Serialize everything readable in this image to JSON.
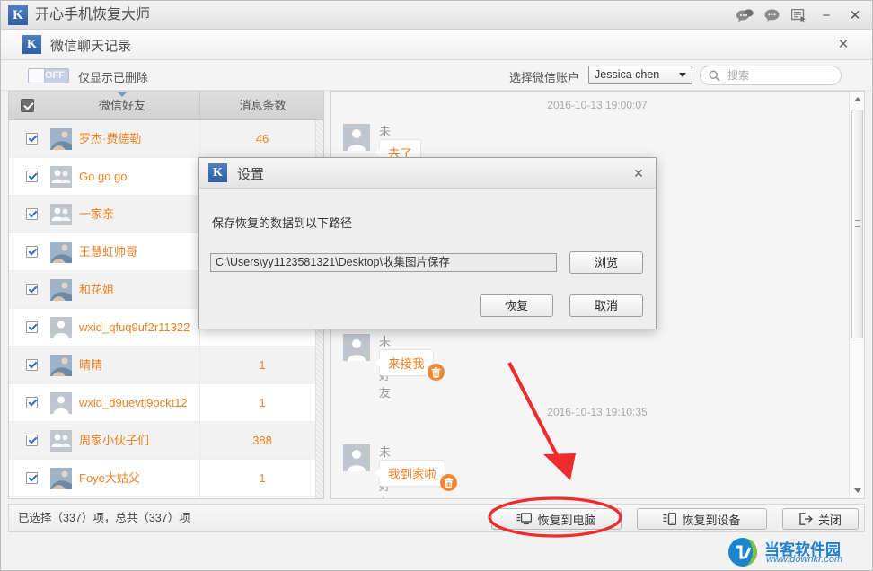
{
  "window": {
    "app_title": "开心手机恢复大师",
    "logo_letter": "K",
    "icons": {
      "chats": "chats-icon",
      "message": "message-icon",
      "feedback": "feedback-icon",
      "minimize": "−",
      "close": "✕"
    }
  },
  "module": {
    "title": "微信聊天记录",
    "close": "✕"
  },
  "toolbar": {
    "toggle_state": "OFF",
    "toggle_label": "仅显示已删除",
    "account_label": "选择微信账户",
    "account_value": "Jessica chen",
    "search_placeholder": "搜索"
  },
  "list": {
    "header": {
      "col_name": "微信好友",
      "col_count": "消息条数"
    },
    "rows": [
      {
        "name": "罗杰·费德勒",
        "count": "46",
        "avatar": "photo",
        "checked": true
      },
      {
        "name": "Go go go",
        "count": "",
        "avatar": "group",
        "checked": true
      },
      {
        "name": "一家亲",
        "count": "",
        "avatar": "group",
        "checked": true
      },
      {
        "name": "王慧虹帅哥",
        "count": "",
        "avatar": "photo",
        "checked": true
      },
      {
        "name": "和花姐",
        "count": "",
        "avatar": "photo",
        "checked": true
      },
      {
        "name": "wxid_qfuq9uf2r11322",
        "count": "",
        "avatar": "person",
        "checked": true
      },
      {
        "name": "晴晴",
        "count": "1",
        "avatar": "photo",
        "checked": true
      },
      {
        "name": "wxid_d9uevtj9ockt12",
        "count": "1",
        "avatar": "person",
        "checked": true
      },
      {
        "name": "周家小伙子们",
        "count": "388",
        "avatar": "group",
        "checked": true
      },
      {
        "name": "Foye大姑父",
        "count": "1",
        "avatar": "photo",
        "checked": true
      }
    ]
  },
  "chat": {
    "timestamps": [
      {
        "text": "2016-10-13 19:00:07"
      },
      {
        "text": "2016-10-13 19:10:35"
      }
    ],
    "messages": [
      {
        "sender": "未知好友",
        "text": "去了"
      },
      {
        "sender": "未知好友",
        "text": "来接我"
      },
      {
        "sender": "未知好友",
        "text": "我到家啦"
      }
    ],
    "delete_icon": "trash-icon"
  },
  "status": {
    "text": "已选择（337）项，总共（337）项"
  },
  "actions": [
    {
      "label": "恢复到电脑",
      "icon": "export-to-computer-icon",
      "highlighted": true
    },
    {
      "label": "恢复到设备",
      "icon": "export-to-device-icon",
      "highlighted": false
    },
    {
      "label": "关闭",
      "icon": "exit-icon",
      "highlighted": false
    }
  ],
  "dialog": {
    "title": "设置",
    "logo_letter": "K",
    "close": "✕",
    "label": "保存恢复的数据到以下路径",
    "path_value": "C:\\Users\\yy1123581321\\Desktop\\收集图片保存",
    "browse_label": "浏览",
    "restore_label": "恢复",
    "cancel_label": "取消"
  },
  "watermark": {
    "name": "当客软件园",
    "url": "www.downkr.com"
  },
  "colors": {
    "accent_orange": "#f08020",
    "brand_blue": "#2b5fa8",
    "annotation_red": "#ef2b2b"
  }
}
